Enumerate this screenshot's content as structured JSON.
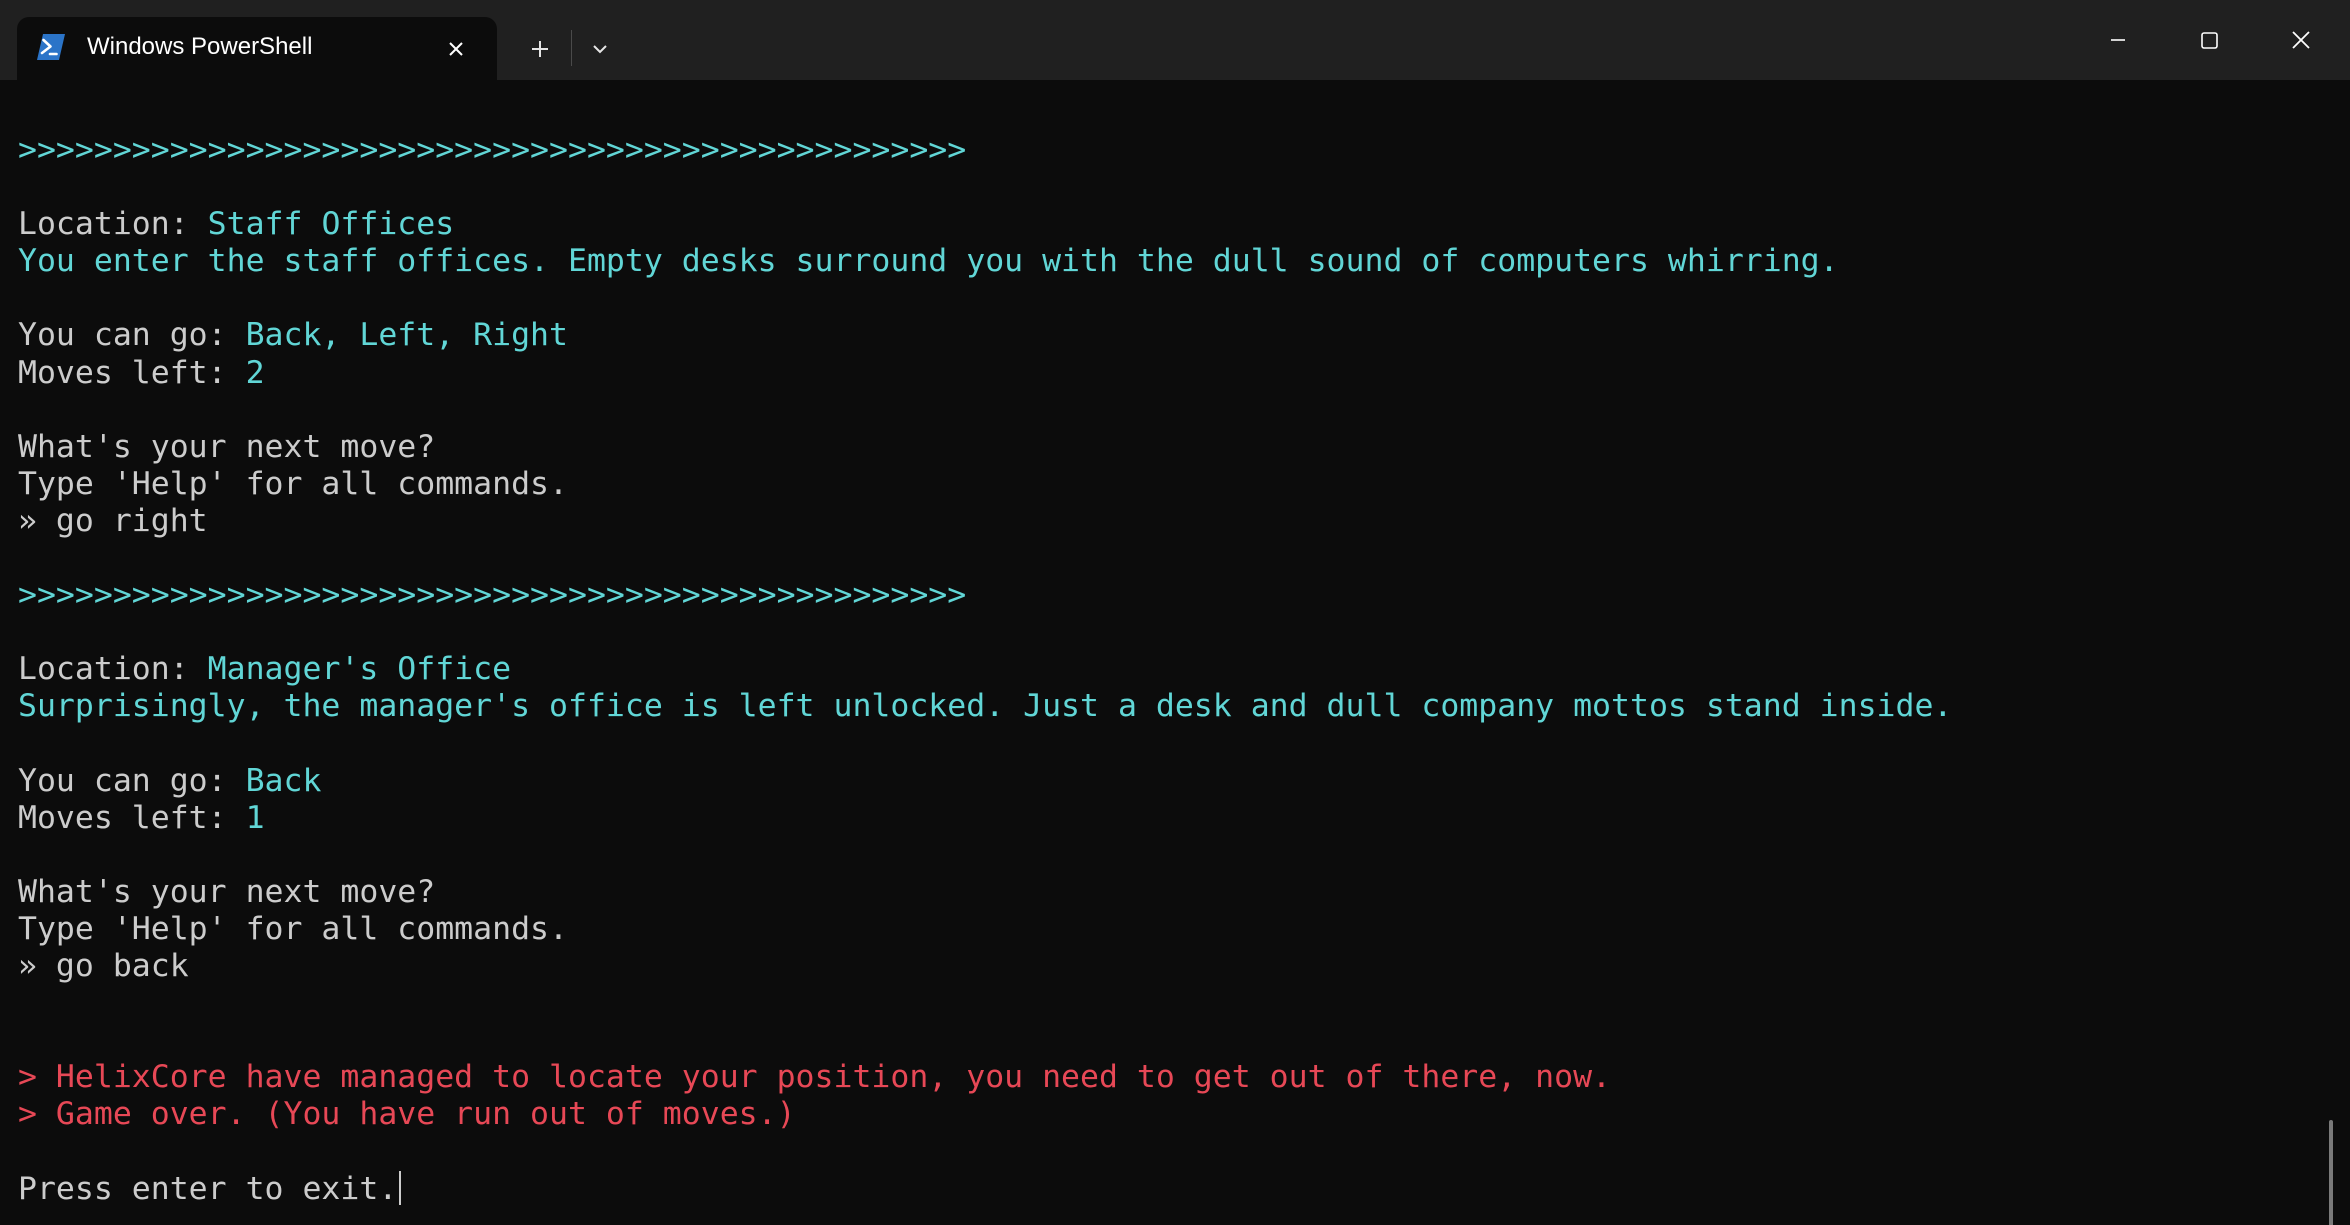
{
  "window": {
    "tab_title": "Windows PowerShell",
    "icons": {
      "app": "powershell-icon",
      "tab_close": "close-icon",
      "new_tab": "plus-icon",
      "dropdown": "chevron-down-icon",
      "minimize": "minimize-icon",
      "maximize": "maximize-icon",
      "close": "close-icon"
    }
  },
  "colors": {
    "background": "#0c0c0c",
    "titlebar": "#202020",
    "text": "#cccccc",
    "cyan": "#61d6d6",
    "red": "#e74856",
    "powershell_blue": "#2b74c8"
  },
  "terminal": {
    "lines": [
      {
        "segments": [
          {
            "text": ">>>>>>>>>>>>>>>>>>>>>>>>>>>>>>>>>>>>>>>>>>>>>>>>>>",
            "color": "cyan"
          }
        ]
      },
      {
        "segments": []
      },
      {
        "segments": [
          {
            "text": "Location: ",
            "color": "white"
          },
          {
            "text": "Staff Offices",
            "color": "cyan"
          }
        ]
      },
      {
        "segments": [
          {
            "text": "You enter the staff offices. Empty desks surround you with the dull sound of computers whirring.",
            "color": "cyan"
          }
        ]
      },
      {
        "segments": []
      },
      {
        "segments": [
          {
            "text": "You can go: ",
            "color": "white"
          },
          {
            "text": "Back, Left, Right",
            "color": "cyan"
          }
        ]
      },
      {
        "segments": [
          {
            "text": "Moves left: ",
            "color": "white"
          },
          {
            "text": "2",
            "color": "cyan"
          }
        ]
      },
      {
        "segments": []
      },
      {
        "segments": [
          {
            "text": "What's your next move?",
            "color": "white"
          }
        ]
      },
      {
        "segments": [
          {
            "text": "Type 'Help' for all commands.",
            "color": "white"
          }
        ]
      },
      {
        "segments": [
          {
            "text": "» go right",
            "color": "white"
          }
        ]
      },
      {
        "segments": []
      },
      {
        "segments": [
          {
            "text": ">>>>>>>>>>>>>>>>>>>>>>>>>>>>>>>>>>>>>>>>>>>>>>>>>>",
            "color": "cyan"
          }
        ]
      },
      {
        "segments": []
      },
      {
        "segments": [
          {
            "text": "Location: ",
            "color": "white"
          },
          {
            "text": "Manager's Office",
            "color": "cyan"
          }
        ]
      },
      {
        "segments": [
          {
            "text": "Surprisingly, the manager's office is left unlocked. Just a desk and dull company mottos stand inside.",
            "color": "cyan"
          }
        ]
      },
      {
        "segments": []
      },
      {
        "segments": [
          {
            "text": "You can go: ",
            "color": "white"
          },
          {
            "text": "Back",
            "color": "cyan"
          }
        ]
      },
      {
        "segments": [
          {
            "text": "Moves left: ",
            "color": "white"
          },
          {
            "text": "1",
            "color": "cyan"
          }
        ]
      },
      {
        "segments": []
      },
      {
        "segments": [
          {
            "text": "What's your next move?",
            "color": "white"
          }
        ]
      },
      {
        "segments": [
          {
            "text": "Type 'Help' for all commands.",
            "color": "white"
          }
        ]
      },
      {
        "segments": [
          {
            "text": "» go back",
            "color": "white"
          }
        ]
      },
      {
        "segments": []
      },
      {
        "segments": []
      },
      {
        "segments": [
          {
            "text": "> HelixCore have managed to locate your position, you need to get out of there, now.",
            "color": "red"
          }
        ]
      },
      {
        "segments": [
          {
            "text": "> Game over. (You have run out of moves.)",
            "color": "red"
          }
        ]
      },
      {
        "segments": []
      },
      {
        "segments": [
          {
            "text": "Press enter to exit.",
            "color": "white"
          }
        ],
        "cursor": true
      }
    ]
  }
}
